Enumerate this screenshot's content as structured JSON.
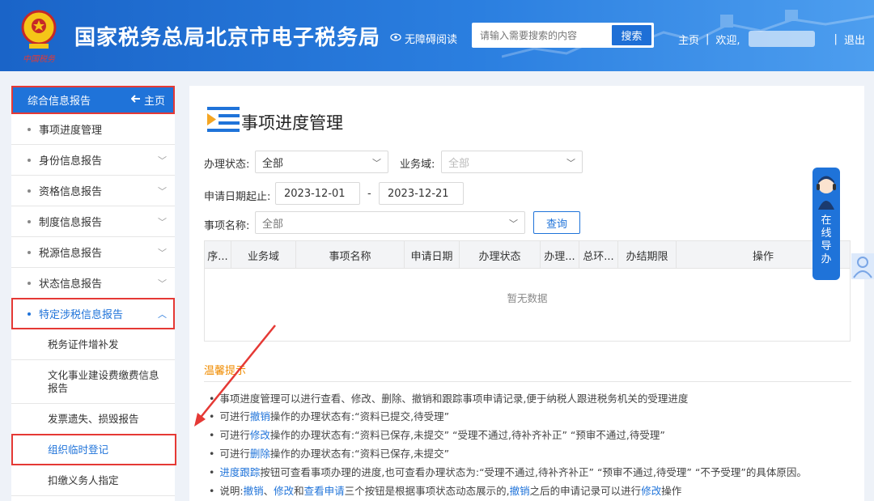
{
  "header": {
    "site_title": "国家税务总局北京市电子税务局",
    "accessible_label": "无障碍阅读",
    "search_placeholder": "请输入需要搜索的内容",
    "search_button": "搜索",
    "home_link": "主页",
    "welcome": "欢迎,",
    "logout": "退出",
    "sep1": "|",
    "sep2": "|",
    "emblem_text": "中国税务"
  },
  "sidebar": {
    "head_label": "综合信息报告",
    "home_label": "主页",
    "items": [
      {
        "label": "事项进度管理"
      },
      {
        "label": "身份信息报告"
      },
      {
        "label": "资格信息报告"
      },
      {
        "label": "制度信息报告"
      },
      {
        "label": "税源信息报告"
      },
      {
        "label": "状态信息报告"
      },
      {
        "label": "特定涉税信息报告"
      }
    ],
    "sub_items": [
      {
        "label": "税务证件增补发"
      },
      {
        "label": "文化事业建设费缴费信息报告"
      },
      {
        "label": "发票遗失、损毁报告"
      },
      {
        "label": "组织临时登记"
      },
      {
        "label": "扣缴义务人指定"
      }
    ]
  },
  "main": {
    "title": "事项进度管理",
    "filters": {
      "status_label": "办理状态:",
      "status_value": "全部",
      "domain_label": "业务域:",
      "domain_value": "全部",
      "date_label": "申请日期起止:",
      "date_from": "2023-12-01",
      "date_sep": "-",
      "date_to": "2023-12-21",
      "name_label": "事项名称:",
      "name_value": "全部",
      "query_button": "查询"
    },
    "table": {
      "columns": [
        "序...",
        "业务域",
        "事项名称",
        "申请日期",
        "办理状态",
        "办理...",
        "总环...",
        "办结期限",
        "操作"
      ],
      "empty_text": "暂无数据"
    },
    "tips": {
      "title": "温馨提示",
      "l1": "事项进度管理可以进行查看、修改、删除、撤销和跟踪事项申请记录,便于纳税人跟进税务机关的受理进度",
      "l2a": "可进行",
      "l2b": "撤销",
      "l2c": "操作的办理状态有:“资料已提交,待受理”",
      "l3a": "可进行",
      "l3b": "修改",
      "l3c": "操作的办理状态有:“资料已保存,未提交” “受理不通过,待补齐补正” “预审不通过,待受理”",
      "l4a": "可进行",
      "l4b": "删除",
      "l4c": "操作的办理状态有:“资料已保存,未提交”",
      "l5a": "进度跟踪",
      "l5b": "按钮可查看事项办理的进度,也可查看办理状态为:“受理不通过,待补齐补正” “预审不通过,待受理” “不予受理”的具体原因。",
      "l6a": "说明:",
      "l6b": "撤销",
      "l6c": "、",
      "l6d": "修改",
      "l6e": "和",
      "l6f": "查看申请",
      "l6g": "三个按钮是根据事项状态动态展示的,",
      "l6h": "撤销",
      "l6i": "之后的申请记录可以进行",
      "l6j": "修改",
      "l6k": "操作"
    }
  },
  "helper": {
    "label_chars": [
      "在",
      "线",
      "导",
      "办"
    ]
  },
  "colors": {
    "header_blue": "#1f73d9",
    "highlight_red": "#e53935",
    "tip_orange": "#f08c00"
  }
}
